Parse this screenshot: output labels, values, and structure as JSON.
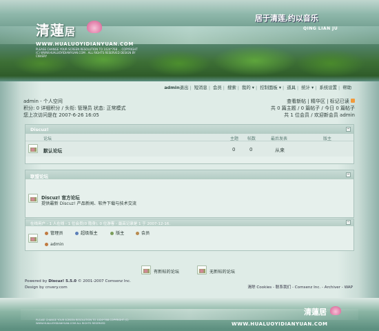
{
  "header": {
    "logo_main": "清蓮",
    "logo_ju": "居",
    "url": "WWW.HUALUOYIDIANYUAN.COM",
    "fine_print": "PLEASE CHANGE YOUR SCREEN RESOLUTION TO 1024*768 ... COPYRIGHT (C) WWW.HUALUOYIDIANYUAN.COM . ALL RIGHTS RESERVED DESIGN BY CNVERY",
    "slogan": "居于清莲,约以音乐",
    "slogan_pinyin": "QING LIAN JU"
  },
  "nav": {
    "user": "admin",
    "items": [
      "退出",
      "短消息",
      "会员",
      "搜索",
      "我的",
      "控制面板",
      "道具",
      "统计",
      "系统设置",
      "帮助"
    ]
  },
  "userinfo": {
    "title": "admin - 个人空间",
    "line2": "积分: 0 详细积分 / 头衔: 管理员 状态: 正常模式",
    "line3": "您上次访问是在 2007-6-26 16:05",
    "right1": "查看新帖 | 精华区 | 标记已读",
    "right2": "共 0 篇主题 / 0 篇帖子 / 今日 0 篇帖子",
    "right3": "共 1 位会员 / 欢迎新会员 admin"
  },
  "forum1": {
    "title": "Discuz!",
    "headers": [
      "论坛",
      "主题",
      "帖数",
      "最后发表",
      "版主"
    ],
    "row": {
      "name": "默认论坛",
      "topics": "0",
      "posts": "0",
      "last": "从来"
    }
  },
  "links": {
    "title": "联盟论坛",
    "name": "Discuz! 官方论坛",
    "desc": "提供最新 Discuz! 产品新闻、软件下载与技术交流"
  },
  "online": {
    "bar": "在线用户 - 1 人在线 - 1 位会员(0 隐身), 0 位游客 - 最高记录是 1 于 2007-12-16.",
    "legend": [
      "管理员",
      "超级版主",
      "版主",
      "会员"
    ],
    "users": [
      "admin"
    ]
  },
  "status_legend": [
    "有新帖的论坛",
    "无新帖的论坛"
  ],
  "footer": {
    "powered": "Powered by",
    "product": "Discuz! 5.5.0",
    "copyright": "© 2001-2007 Comsenz Inc.",
    "design": "Design by cnvery.com",
    "right": "清除 Cookies - 联系我们 - Comsenz Inc. - Archiver - WAP"
  },
  "bottom": {
    "url": "WWW.HUALUOYIDIANYUAN.COM",
    "logo": "清蓮居",
    "fine_print": "PLEASE CHANGE YOUR SCREEN RESOLUTION TO 1024*768 COPYRIGHT (C) WWW.HUALUOYIDIANYUAN.COM ALL RIGHTS RESERVED"
  },
  "colors": {
    "accent": "#b3ccc4",
    "banner": "#4f7f63",
    "pink": "#d6588e"
  }
}
